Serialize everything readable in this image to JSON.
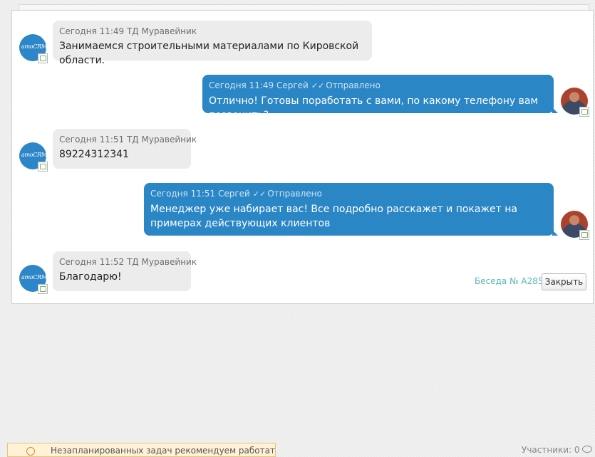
{
  "messages": [
    {
      "direction": "incoming",
      "meta": "Сегодня 11:49 ТД Муравейник",
      "text": "Занимаемся строительными материалами по Кировской области.",
      "avatar": "amocrm-logo"
    },
    {
      "direction": "outgoing",
      "meta": "Сегодня 11:49 Сергей",
      "status": "Отправлено",
      "text": "Отлично! Готовы поработать с вами, по какому телефону вам позвонить?",
      "avatar": "user-photo"
    },
    {
      "direction": "incoming",
      "meta": "Сегодня 11:51 ТД Муравейник",
      "text": "89224312341",
      "avatar": "amocrm-logo"
    },
    {
      "direction": "outgoing",
      "meta": "Сегодня 11:51 Сергей",
      "status": "Отправлено",
      "text": "Менеджер уже набирает вас! Все подробно расскажет и покажет на примерах действующих клиентов",
      "avatar": "user-photo"
    },
    {
      "direction": "incoming",
      "meta": "Сегодня 11:52 ТД Муравейник",
      "text": "Благодарю!",
      "avatar": "amocrm-logo"
    }
  ],
  "avatar_logo_text": "amoCRM",
  "check_icon": "✓✓",
  "conversation": {
    "label": "Беседа № А285",
    "close_label": "Закрыть"
  },
  "warning": {
    "text": "Незапланированных задач рекомендуем работать"
  },
  "participants": {
    "label": "Участники: 0"
  },
  "colors": {
    "outgoing_bubble": "#2b86c6",
    "incoming_bubble": "#ececec",
    "accent_teal": "#57b5b5"
  }
}
